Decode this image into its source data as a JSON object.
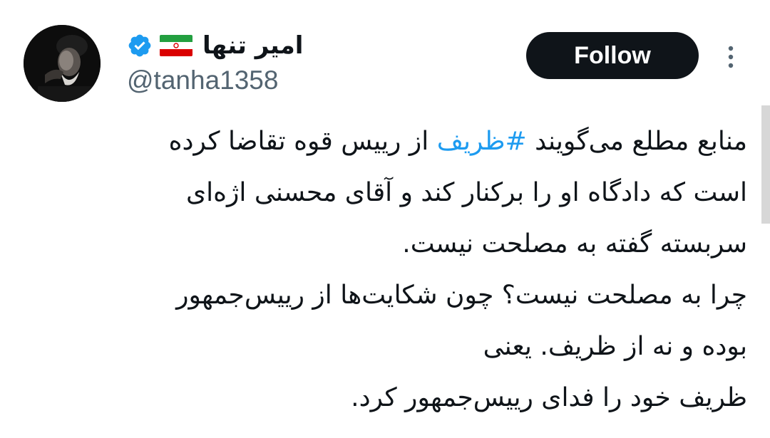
{
  "author": {
    "display_name": "امیر تنها",
    "handle": "@tanha1358",
    "verified": true,
    "flag_icon": "iran-flag-icon",
    "verified_color": "#1d9bf0"
  },
  "actions": {
    "follow_label": "Follow",
    "more_icon": "vertical-ellipsis-icon"
  },
  "tweet": {
    "line1_pre": "منابع مطلع می‌گویند ",
    "hashtag": "#ظریف",
    "line1_post": " از رییس قوه تقاضا کرده",
    "line2": "است که دادگاه او را برکنار کند و آقای محسنی اژه‌ای",
    "line3": "سربسته گفته به مصلحت نیست.",
    "line4": "چرا به مصلحت نیست؟ چون شکایت‌ها از رییس‌جمهور",
    "line5": "بوده و نه از ظریف. یعنی",
    "line6": "ظریف خود را فدای رییس‌جمهور کرد."
  },
  "colors": {
    "text": "#0f1419",
    "secondary": "#536471",
    "link": "#1d9bf0",
    "button_bg": "#0f1419"
  }
}
